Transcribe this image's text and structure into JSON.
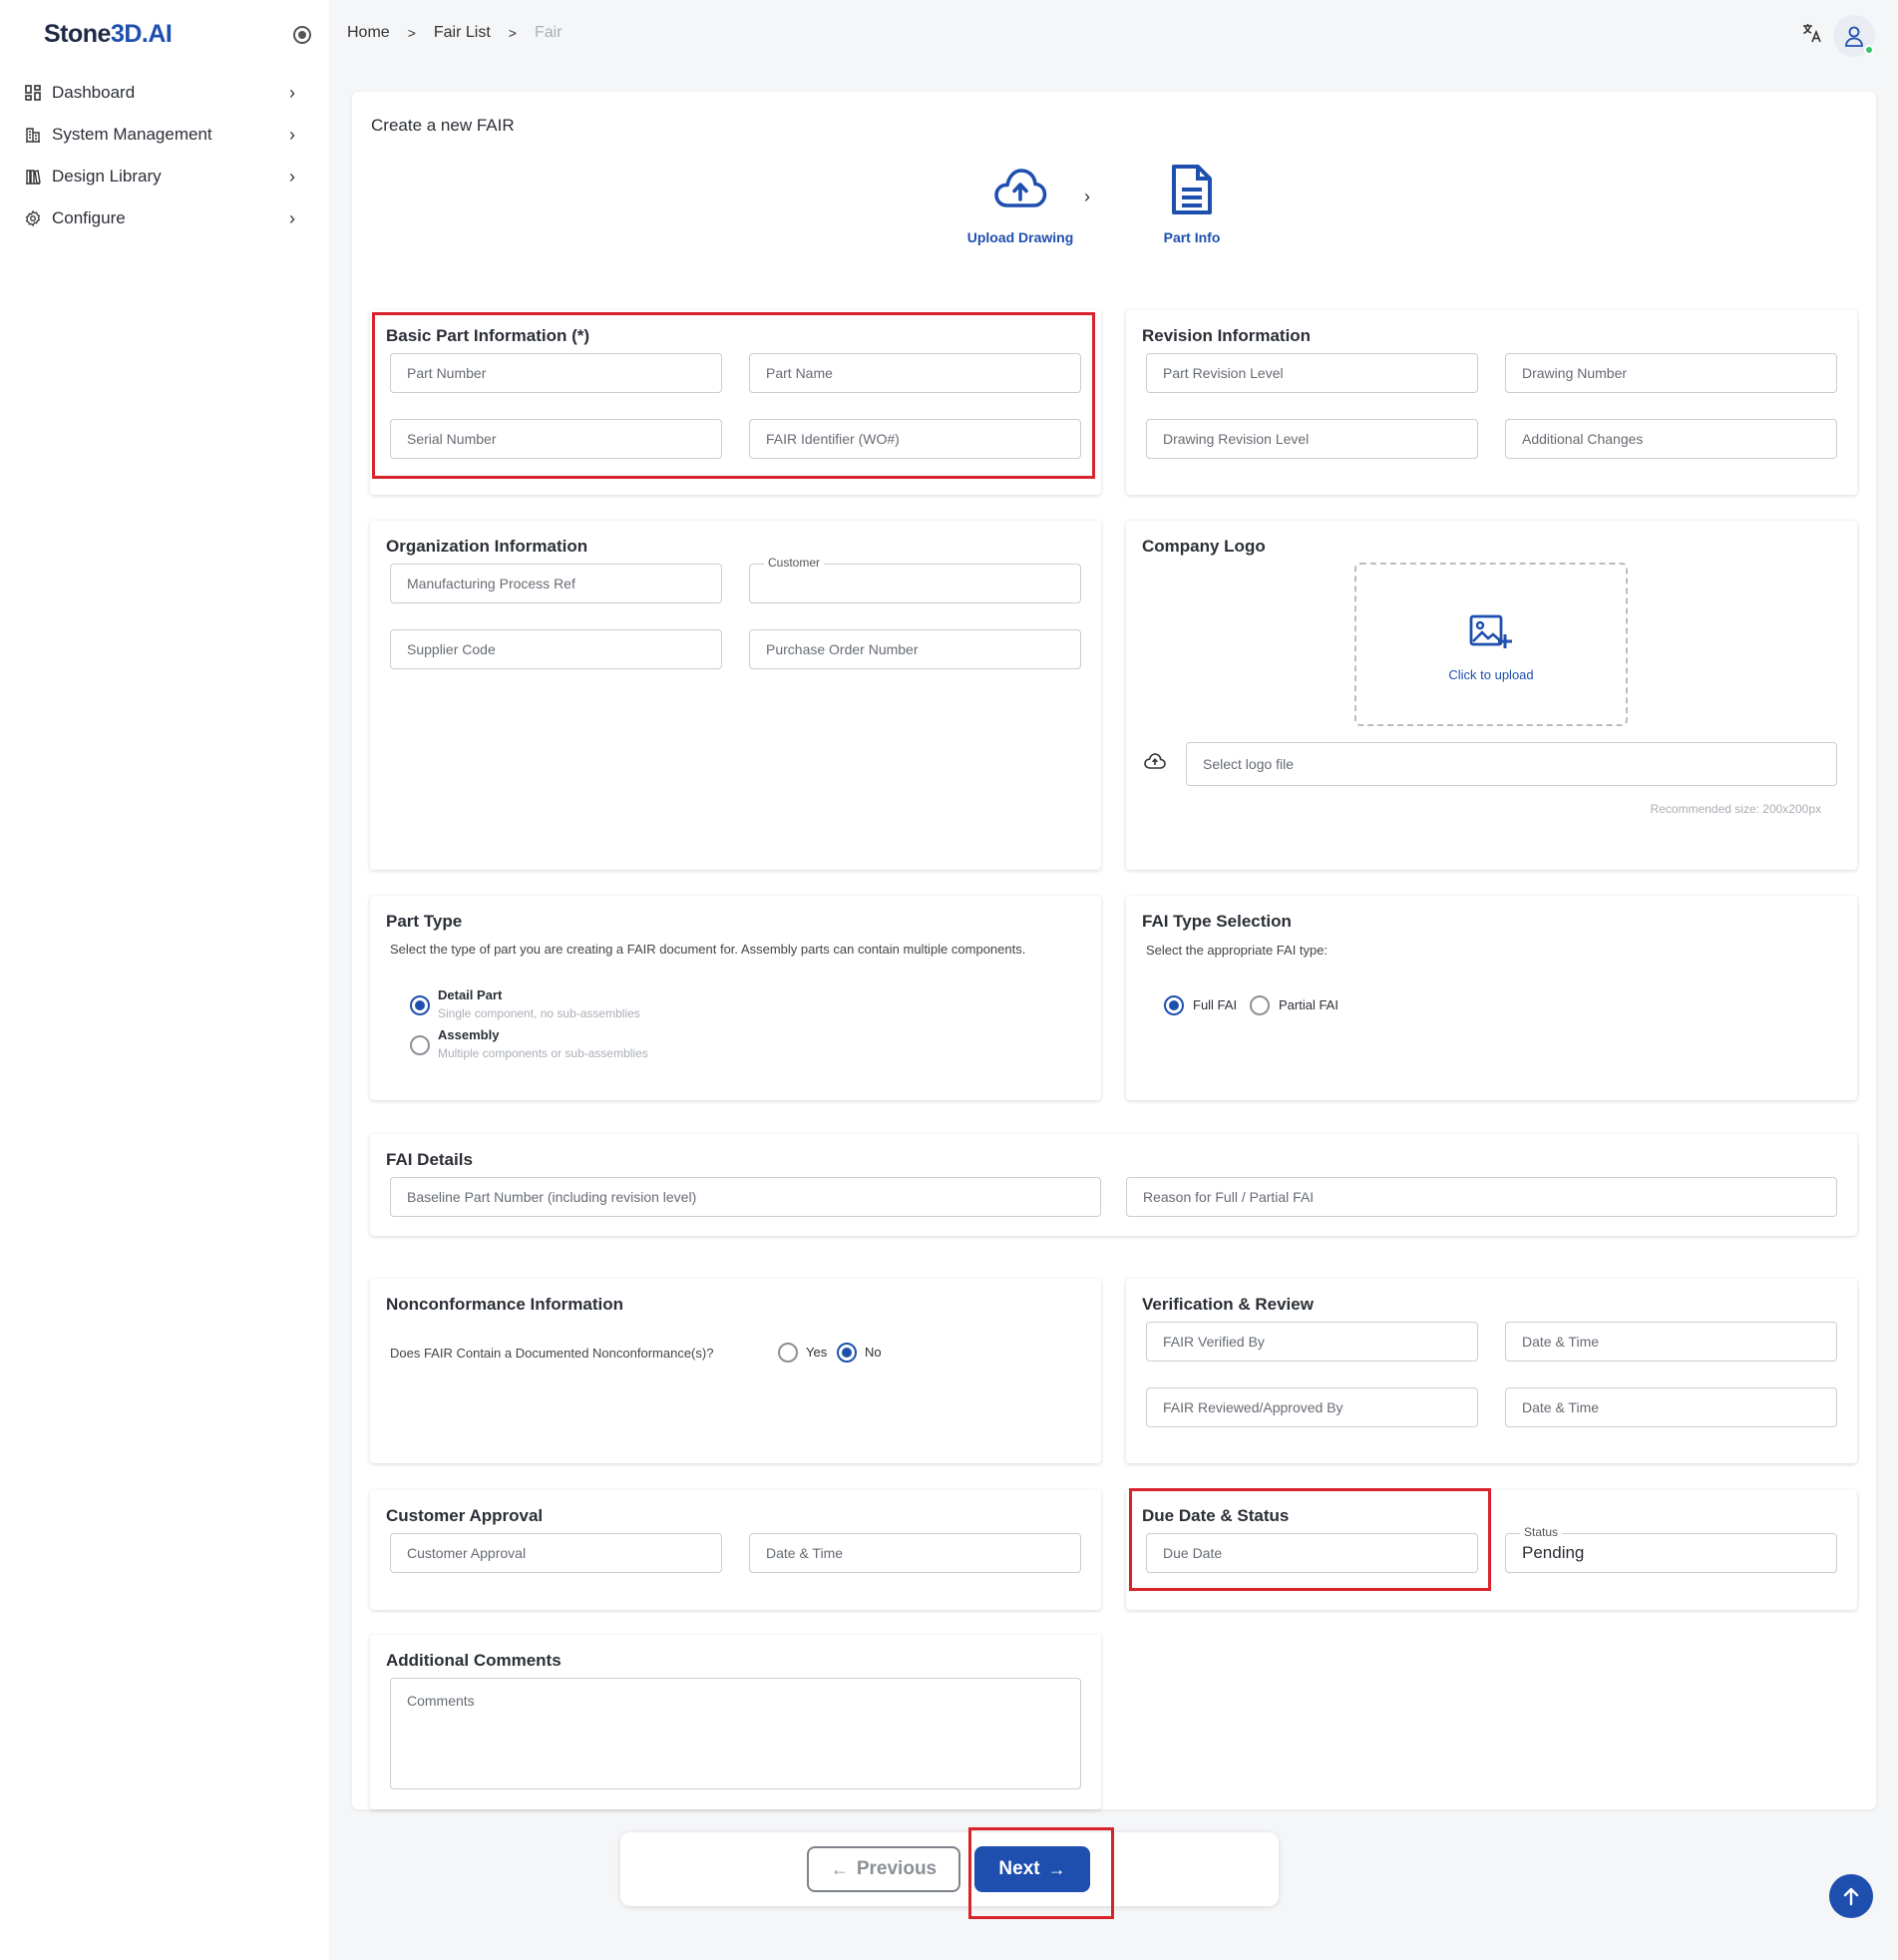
{
  "app": {
    "logo_main": "Stone",
    "logo_accent": "3D.AI"
  },
  "sidebar": {
    "items": [
      {
        "label": "Dashboard",
        "icon": "dashboard-grid-icon"
      },
      {
        "label": "System Management",
        "icon": "building-icon"
      },
      {
        "label": "Design Library",
        "icon": "library-icon"
      },
      {
        "label": "Configure",
        "icon": "gear-icon"
      }
    ]
  },
  "breadcrumb": {
    "home": "Home",
    "fair_list": "Fair List",
    "current": "Fair"
  },
  "page": {
    "title": "Create a new FAIR"
  },
  "stepper": {
    "step1": "Upload Drawing",
    "step2": "Part Info"
  },
  "basic": {
    "title": "Basic Part Information (*)",
    "part_number": "Part Number",
    "part_name": "Part Name",
    "serial_number": "Serial Number",
    "fair_identifier": "FAIR Identifier (WO#)"
  },
  "revision": {
    "title": "Revision Information",
    "part_revision_level": "Part Revision Level",
    "drawing_number": "Drawing Number",
    "drawing_revision_level": "Drawing Revision Level",
    "additional_changes": "Additional Changes"
  },
  "organization": {
    "title": "Organization Information",
    "manufacturing_process_ref": "Manufacturing Process Ref",
    "customer_label": "Customer",
    "supplier_code": "Supplier Code",
    "purchase_order_number": "Purchase Order Number"
  },
  "logo": {
    "title": "Company Logo",
    "click_to_upload": "Click to upload",
    "select_logo_file": "Select logo file",
    "recommended": "Recommended size: 200x200px"
  },
  "part_type": {
    "title": "Part Type",
    "description": "Select the type of part you are creating a FAIR document for. Assembly parts can contain multiple components.",
    "detail_title": "Detail Part",
    "detail_sub": "Single component, no sub-assemblies",
    "assembly_title": "Assembly",
    "assembly_sub": "Multiple components or sub-assemblies",
    "selected": "Detail Part"
  },
  "fai_type": {
    "title": "FAI Type Selection",
    "description": "Select the appropriate FAI type:",
    "full": "Full FAI",
    "partial": "Partial FAI",
    "selected": "Full FAI"
  },
  "fai_details": {
    "title": "FAI Details",
    "baseline_part_number": "Baseline Part Number (including revision level)",
    "reason": "Reason for Full / Partial FAI"
  },
  "nonconformance": {
    "title": "Nonconformance Information",
    "question": "Does FAIR Contain a Documented Nonconformance(s)?",
    "yes": "Yes",
    "no": "No",
    "selected": "No"
  },
  "verification": {
    "title": "Verification & Review",
    "verified_by": "FAIR Verified By",
    "date_time_1": "Date & Time",
    "reviewed_by": "FAIR Reviewed/Approved By",
    "date_time_2": "Date & Time"
  },
  "customer_approval": {
    "title": "Customer Approval",
    "approval": "Customer Approval",
    "date_time": "Date & Time"
  },
  "due_status": {
    "title": "Due Date & Status",
    "due_date": "Due Date",
    "status_label": "Status",
    "status_value": "Pending"
  },
  "comments": {
    "title": "Additional Comments",
    "placeholder": "Comments"
  },
  "footer": {
    "previous": "Previous",
    "next": "Next"
  },
  "colors": {
    "accent": "#1e4fae",
    "highlight": "#d8232a",
    "online": "#37c26b"
  }
}
